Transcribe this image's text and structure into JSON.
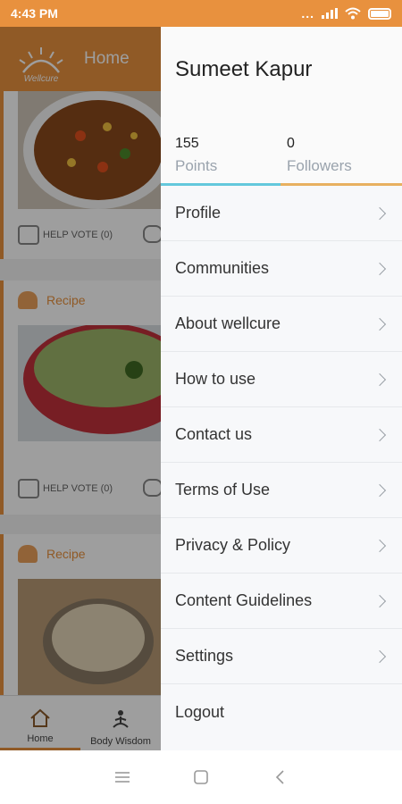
{
  "status_bar": {
    "time": "4:43 PM",
    "dots": "..."
  },
  "app": {
    "title": "Home",
    "logo_text": "Wellcure",
    "cards": [
      {
        "vote_label": "HELP VOTE (0)"
      },
      {
        "category": "Recipe",
        "vote_label": "HELP VOTE (0)"
      },
      {
        "category": "Recipe"
      }
    ],
    "bottom_nav": [
      "Home",
      "Body Wisdom"
    ]
  },
  "drawer": {
    "user_name": "Sumeet Kapur",
    "points": {
      "value": "155",
      "label": "Points"
    },
    "followers": {
      "value": "0",
      "label": "Followers"
    },
    "menu": [
      {
        "label": "Profile"
      },
      {
        "label": "Communities"
      },
      {
        "label": "About wellcure"
      },
      {
        "label": "How to use"
      },
      {
        "label": "Contact us"
      },
      {
        "label": "Terms of Use"
      },
      {
        "label": "Privacy & Policy"
      },
      {
        "label": "Content Guidelines"
      },
      {
        "label": "Settings"
      },
      {
        "label": "Logout"
      }
    ]
  },
  "colors": {
    "accent": "#e8913e",
    "points_underline": "#64c8dc",
    "followers_underline": "#e8b060"
  }
}
